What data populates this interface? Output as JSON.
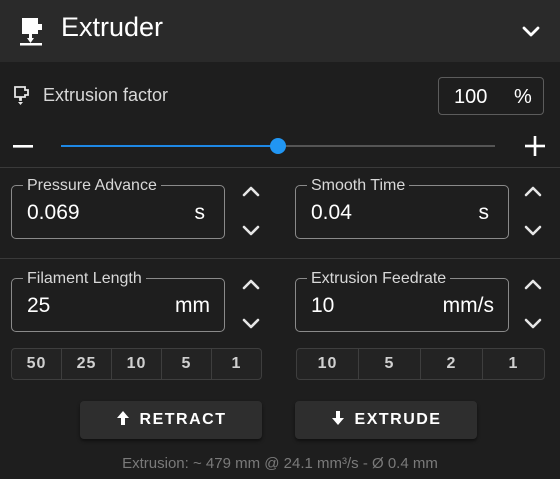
{
  "header": {
    "title": "Extruder",
    "icon": "extruder-icon",
    "collapse_icon": "chevron-down-icon"
  },
  "factor": {
    "label": "Extrusion factor",
    "value": "100",
    "unit": "%",
    "level": 0.5,
    "minus_icon": "minus-icon",
    "plus_icon": "plus-icon"
  },
  "pressure_advance": {
    "label": "Pressure Advance",
    "value": "0.069",
    "unit": "s"
  },
  "smooth_time": {
    "label": "Smooth Time",
    "value": "0.04",
    "unit": "s"
  },
  "filament_length": {
    "label": "Filament Length",
    "value": "25",
    "unit": "mm",
    "presets": [
      "50",
      "25",
      "10",
      "5",
      "1"
    ]
  },
  "feedrate": {
    "label": "Extrusion Feedrate",
    "value": "10",
    "unit": "mm/s",
    "presets": [
      "10",
      "5",
      "2",
      "1"
    ]
  },
  "actions": {
    "retract": "RETRACT",
    "extrude": "EXTRUDE"
  },
  "footer": {
    "text": "Extrusion: ~ 479 mm @ 24.1 mm³/s - Ø 0.4 mm"
  },
  "colors": {
    "accent": "#2196f3",
    "background": "#1e1e1e",
    "header": "#2a2a2a"
  }
}
